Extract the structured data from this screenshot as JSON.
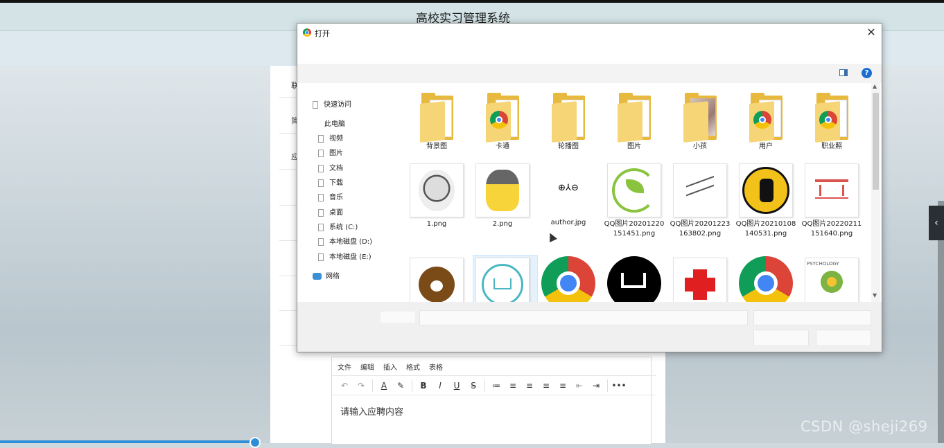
{
  "app": {
    "title": "高校实习管理系统"
  },
  "form": {
    "labels": [
      "联",
      "简",
      "应"
    ]
  },
  "editor": {
    "menu": [
      "文件",
      "编辑",
      "插入",
      "格式",
      "表格"
    ],
    "tools": [
      "↶",
      "↷",
      "A",
      "✎",
      "B",
      "I",
      "U",
      "S",
      "≔",
      "≡",
      "≡",
      "≡",
      "≡",
      "⇤",
      "⇥",
      "•••"
    ],
    "placeholder": "请输入应聘内容"
  },
  "dialog": {
    "title": "打开",
    "close": "✕",
    "help": "?",
    "nav": {
      "quick_access": "快速访问",
      "this_pc": "此电脑",
      "items": [
        "视频",
        "图片",
        "文档",
        "下载",
        "音乐",
        "桌面",
        "系统 (C:)",
        "本地磁盘 (D:)",
        "本地磁盘 (E:)"
      ],
      "network": "网络"
    },
    "folders": [
      "背景图",
      "卡通",
      "轮播图",
      "图片",
      "小孩",
      "用户",
      "职业照"
    ],
    "files": [
      "1.png",
      "2.png",
      "author.jpg",
      "QQ图片20201220151451.png",
      "QQ图片20201223163802.png",
      "QQ图片20210108140531.png",
      "QQ图片20220211151640.png"
    ],
    "author_thumb_text": "⊕⅄⊖",
    "psy_text": "PSYCHOLOGY"
  },
  "side_toggle": "‹",
  "watermark": "CSDN @sheji269"
}
